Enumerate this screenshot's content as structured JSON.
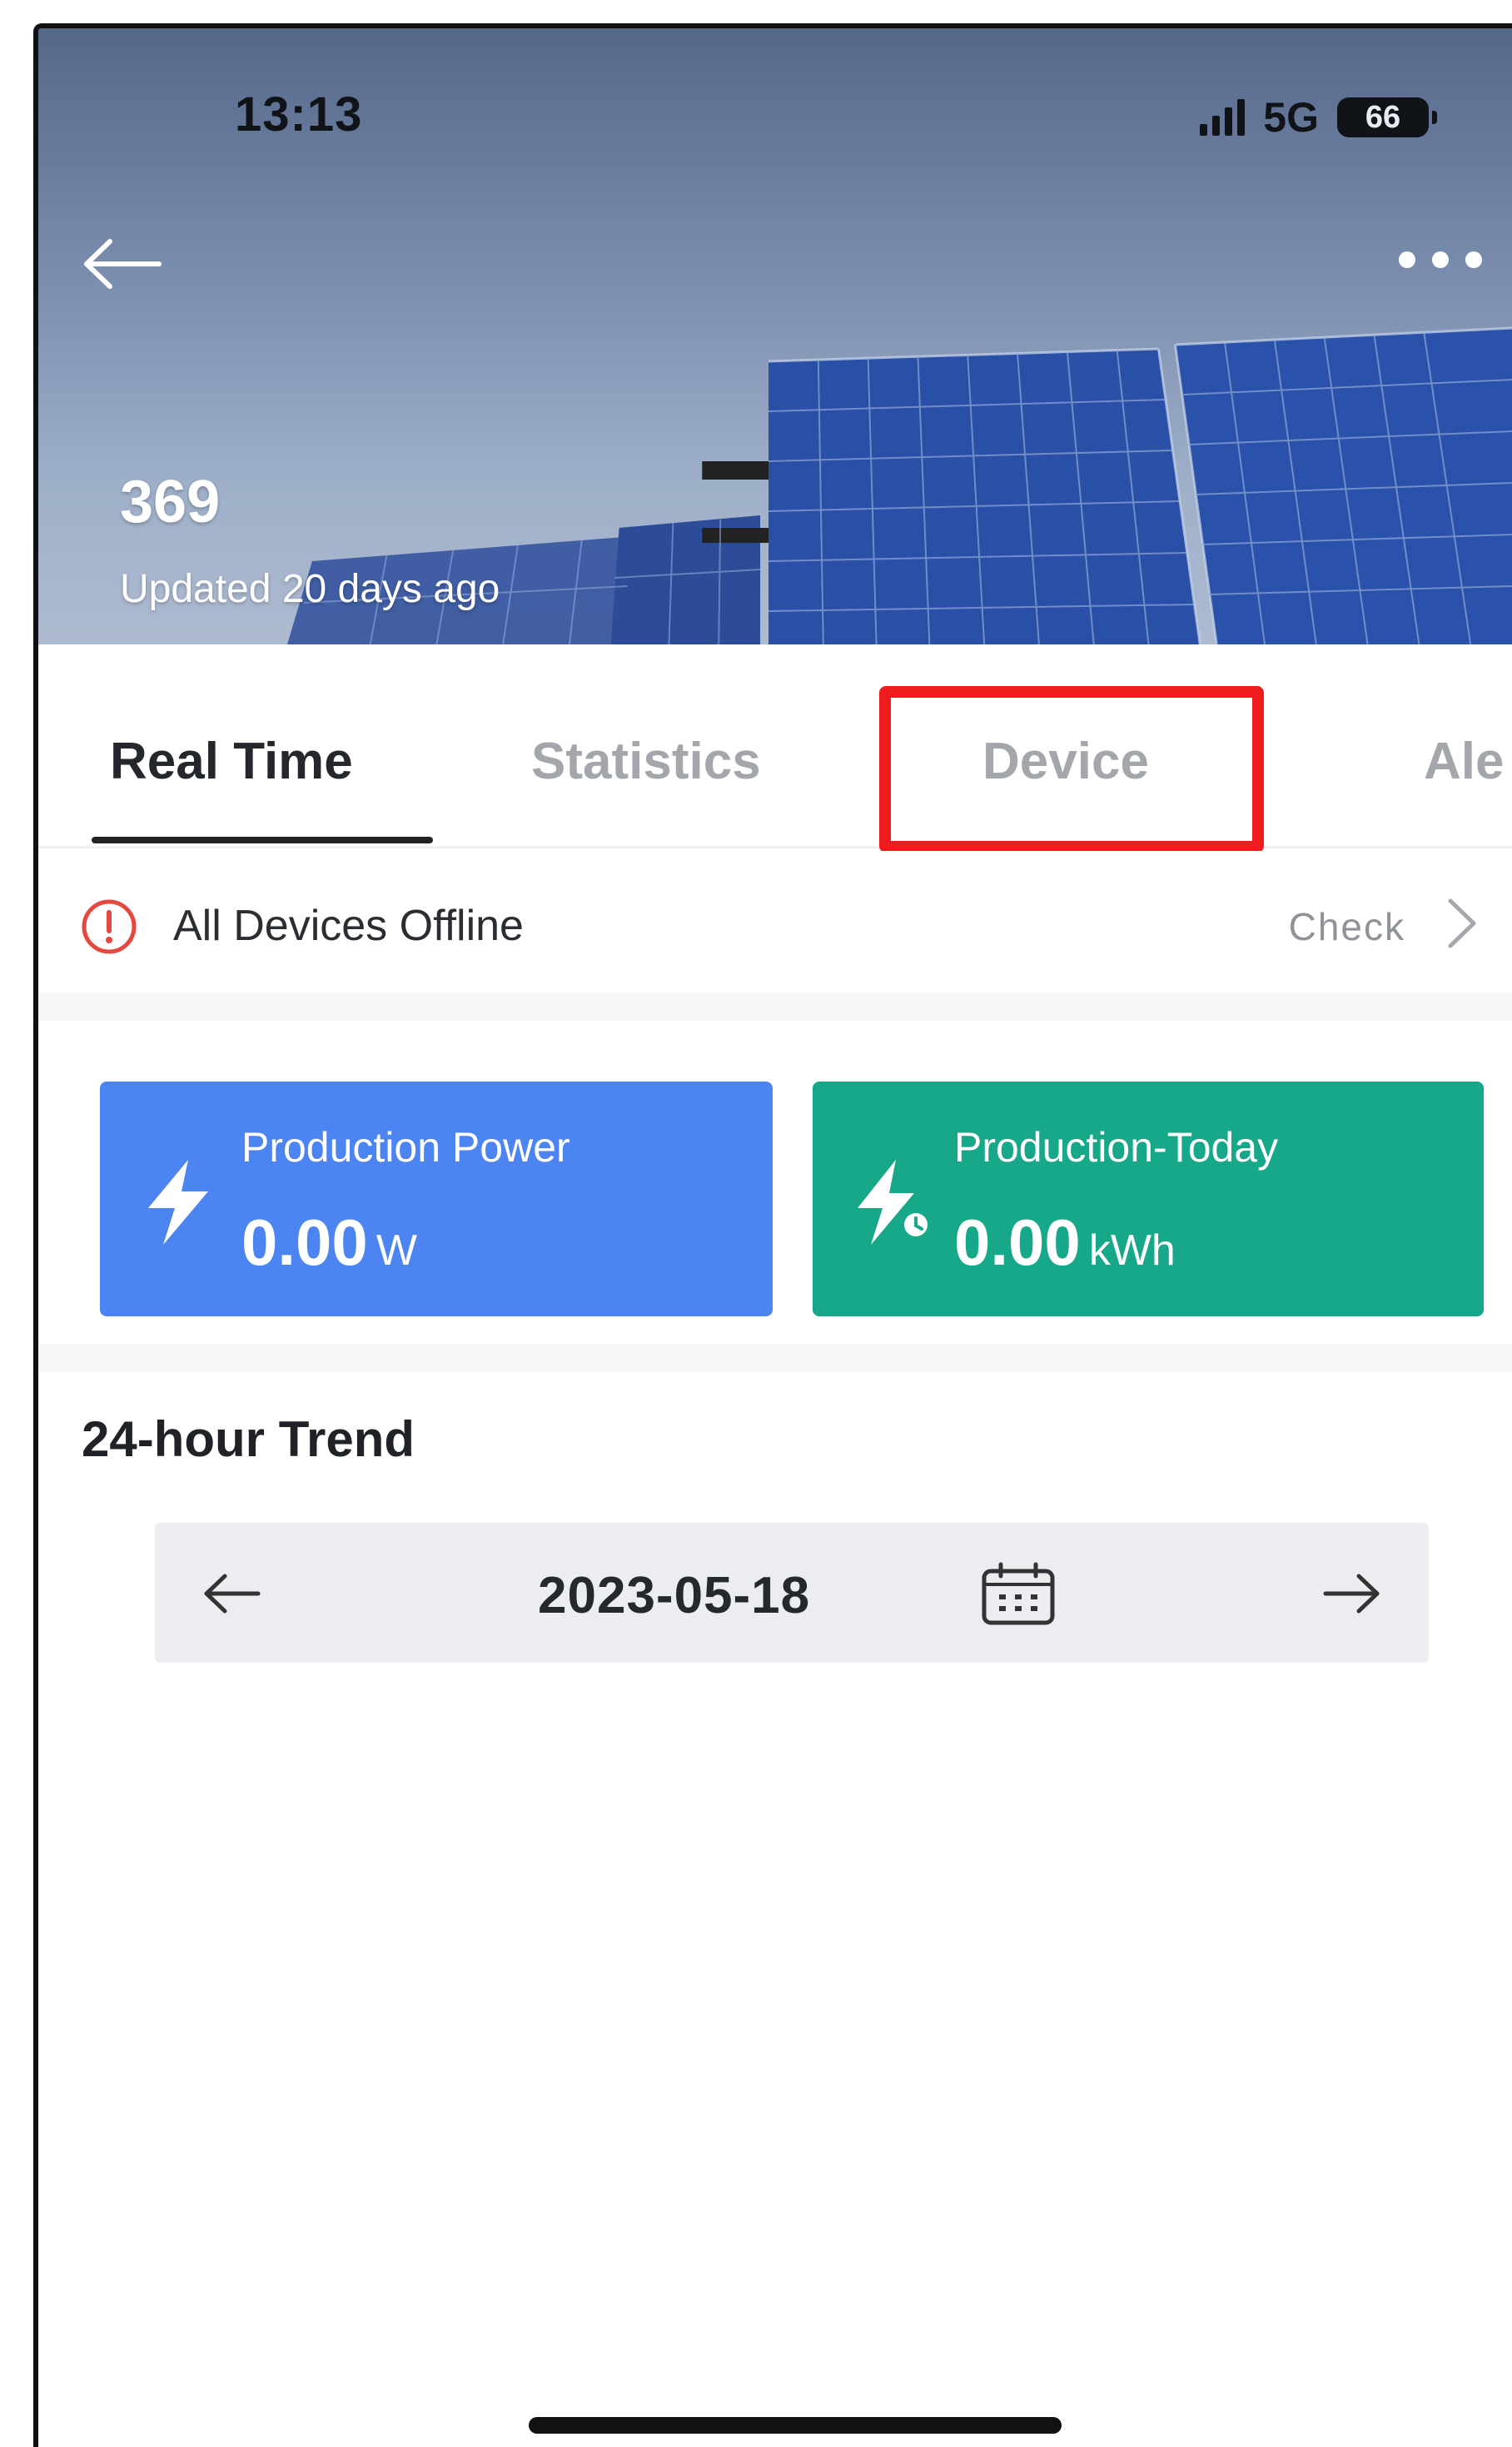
{
  "status_bar": {
    "time": "13:13",
    "network": "5G",
    "battery": "66"
  },
  "header": {
    "plant_name": "369",
    "updated": "Updated 20 days ago"
  },
  "tabs": [
    {
      "label": "Real Time",
      "active": true
    },
    {
      "label": "Statistics",
      "active": false
    },
    {
      "label": "Device",
      "active": false,
      "highlighted": true
    },
    {
      "label": "Ale",
      "active": false
    }
  ],
  "alert": {
    "text": "All Devices Offline",
    "action": "Check"
  },
  "cards": {
    "power": {
      "label": "Production Power",
      "value": "0.00",
      "unit": "W",
      "color": "#4c85f1"
    },
    "today": {
      "label": "Production-Today",
      "value": "0.00",
      "unit": "kWh",
      "color": "#16a889"
    }
  },
  "trend": {
    "title": "24-hour Trend",
    "date": "2023-05-18"
  },
  "colors": {
    "highlight": "#ee1c1c",
    "alert_icon": "#e5483f"
  }
}
